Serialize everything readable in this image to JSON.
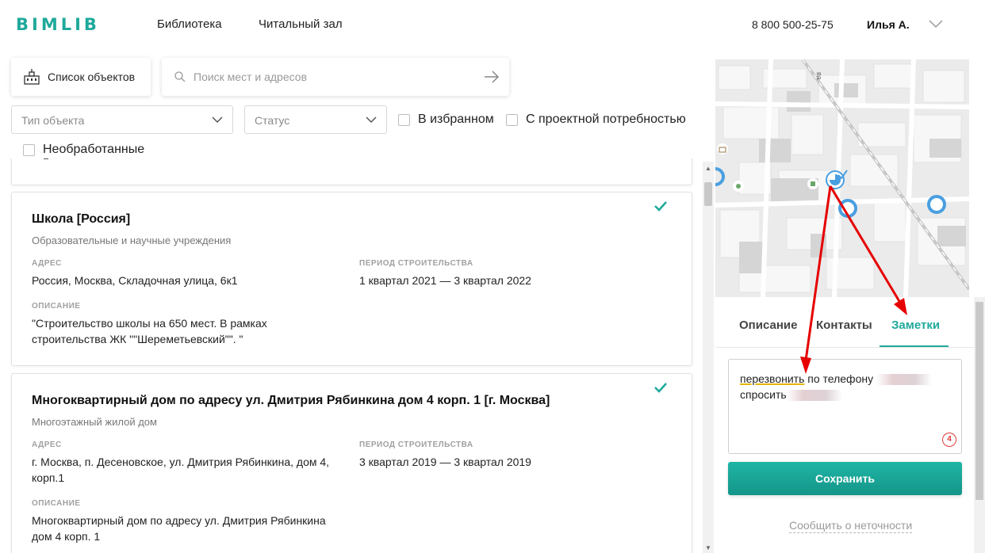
{
  "header": {
    "logo": "BIMLIB",
    "nav": [
      "Библиотека",
      "Читальный зал"
    ],
    "phone": "8 800 500-25-75",
    "user": "Илья А."
  },
  "toolbar": {
    "objects_list_label": "Список объектов",
    "search_placeholder": "Поиск мест и адресов"
  },
  "filters": {
    "object_type_placeholder": "Тип объекта",
    "status_placeholder": "Статус",
    "favorites_label": "В избранном",
    "project_need_label": "С проектной потребностью",
    "unprocessed_label": "Необработанные"
  },
  "cards": [
    {
      "title": "Школа [Россия]",
      "subtitle": "Образовательные и научные учреждения",
      "address_label": "АДРЕС",
      "address": "Россия, Москва, Складочная улица, 6к1",
      "period_label": "ПЕРИОД СТРОИТЕЛЬСТВА",
      "period": "1 квартал 2021 — 3 квартал 2022",
      "description_label": "ОПИСАНИЕ",
      "description_line1": "\"Строительство школы на 650 мест. В рамках",
      "description_line2": "строительства ЖК \"\"Шереметьевский\"\". \""
    },
    {
      "title": "Многоквартирный дом по адресу ул. Дмитрия Рябинкина дом 4 корп. 1 [г. Москва]",
      "subtitle": "Многоэтажный жилой дом",
      "address_label": "АДРЕС",
      "address_line1": "г. Москва, п. Десеновское, ул. Дмитрия Рябинкина, дом 4,",
      "address_line2": "корп.1",
      "period_label": "ПЕРИОД СТРОИТЕЛЬСТВА",
      "period": "3 квартал 2019 — 3 квартал 2019",
      "description_label": "ОПИСАНИЕ",
      "description_line1": "Многоквартирный дом по адресу ул. Дмитрия Рябинкина",
      "description_line2": "дом 4 корп. 1"
    }
  ],
  "panel": {
    "tabs": [
      "Описание",
      "Контакты",
      "Заметки"
    ],
    "active_tab": "Заметки",
    "notes_word1": "перезвонить",
    "notes_word2": " по телефону ",
    "notes_line2": "спросить",
    "counter": "4",
    "save_label": "Сохранить",
    "report_label": "Сообщить о неточности"
  },
  "map": {
    "street_label": "ва"
  },
  "colors": {
    "accent": "#1fa99b",
    "annotation": "#e60000",
    "marker": "#4a9fe0"
  },
  "icons": {
    "objects_list": "building-icon",
    "search": "search-icon",
    "submit": "arrow-right-icon",
    "select": "chevron-down-icon",
    "favorite_tick": "checkmark-icon"
  }
}
